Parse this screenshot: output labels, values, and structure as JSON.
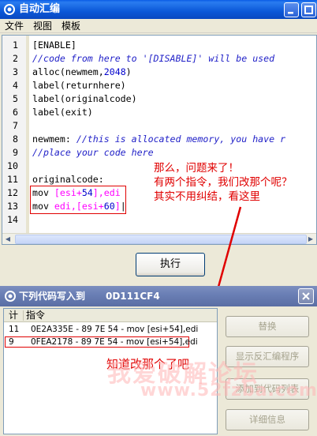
{
  "main_window": {
    "title": "自动汇编",
    "menu": [
      "文件",
      "视图",
      "模板"
    ]
  },
  "editor": {
    "lines": [
      {
        "n": "1",
        "parts": [
          {
            "t": "[ENABLE]",
            "c": "c-kw"
          }
        ]
      },
      {
        "n": "2",
        "parts": [
          {
            "t": "//code from here to '[DISABLE]' will be used",
            "c": "c-cmt"
          }
        ]
      },
      {
        "n": "3",
        "parts": [
          {
            "t": "alloc(newmem,",
            "c": "c-kw"
          },
          {
            "t": "2048",
            "c": "c-num"
          },
          {
            "t": ")",
            "c": "c-kw"
          }
        ]
      },
      {
        "n": "4",
        "parts": [
          {
            "t": "label(returnhere)",
            "c": "c-kw"
          }
        ]
      },
      {
        "n": "5",
        "parts": [
          {
            "t": "label(originalcode)",
            "c": "c-kw"
          }
        ]
      },
      {
        "n": "6",
        "parts": [
          {
            "t": "label(exit)",
            "c": "c-kw"
          }
        ]
      },
      {
        "n": "7",
        "parts": []
      },
      {
        "n": "8",
        "parts": [
          {
            "t": "newmem: ",
            "c": "c-kw"
          },
          {
            "t": "//this is allocated memory, you have r",
            "c": "c-cmt"
          }
        ]
      },
      {
        "n": "9",
        "parts": [
          {
            "t": "//place your code here",
            "c": "c-cmt"
          }
        ]
      },
      {
        "n": "10",
        "parts": []
      },
      {
        "n": "11",
        "parts": [
          {
            "t": "originalcode:",
            "c": "c-kw"
          }
        ]
      },
      {
        "n": "12",
        "parts": [
          {
            "t": "mov ",
            "c": "c-kw"
          },
          {
            "t": "[esi+",
            "c": "c-pink"
          },
          {
            "t": "54",
            "c": "c-num"
          },
          {
            "t": "],edi",
            "c": "c-pink"
          }
        ]
      },
      {
        "n": "13",
        "parts": [
          {
            "t": "mov ",
            "c": "c-kw"
          },
          {
            "t": "edi,",
            "c": "c-pink"
          },
          {
            "t": "[esi+",
            "c": "c-pink"
          },
          {
            "t": "60",
            "c": "c-num"
          },
          {
            "t": "]",
            "c": "c-pink"
          },
          {
            "t": "|",
            "c": "c-kw"
          }
        ]
      },
      {
        "n": "14",
        "parts": []
      }
    ],
    "annotation": [
      "那么，问题来了！",
      "有两个指令，我们改那个呢？",
      "其实不用纠结，看这里"
    ]
  },
  "execute_button": "执行",
  "dialog": {
    "title": "下列代码写入到",
    "address": "0D111CF4",
    "columns": [
      "计",
      "指令"
    ],
    "rows": [
      {
        "count": "11",
        "instr": "0E2A335E - 89 7E 54  - mov [esi+54],edi"
      },
      {
        "count": "9",
        "instr": "0FEA2178 - 89 7E 54  - mov [esi+54],edi"
      }
    ],
    "annotation": "知道改那个了吧",
    "buttons": [
      "替换",
      "显示反汇编程序",
      "添加到代码列表",
      "详细信息"
    ]
  },
  "watermark": {
    "text": "我爱破解论坛",
    "url": "www.52fzba.com"
  },
  "colors": {
    "annotation": "#e00000",
    "titlebar": "#0b58d8"
  }
}
